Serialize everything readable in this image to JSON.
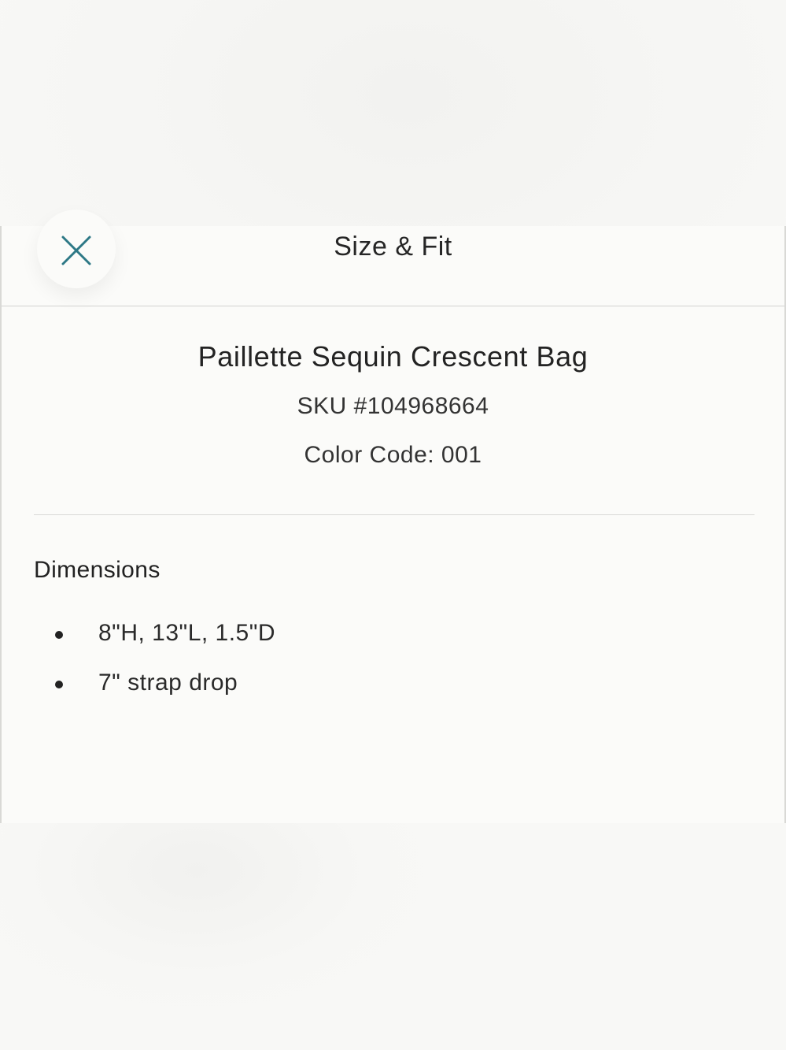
{
  "header": {
    "title": "Size & Fit",
    "close_icon": "close-icon",
    "close_icon_color": "#2d7886"
  },
  "product": {
    "name": "Paillette Sequin Crescent Bag",
    "sku": "SKU #104968664",
    "color_code": "Color Code: 001"
  },
  "dimensions": {
    "heading": "Dimensions",
    "items": [
      "8\"H, 13\"L, 1.5\"D",
      "7\" strap drop"
    ]
  }
}
